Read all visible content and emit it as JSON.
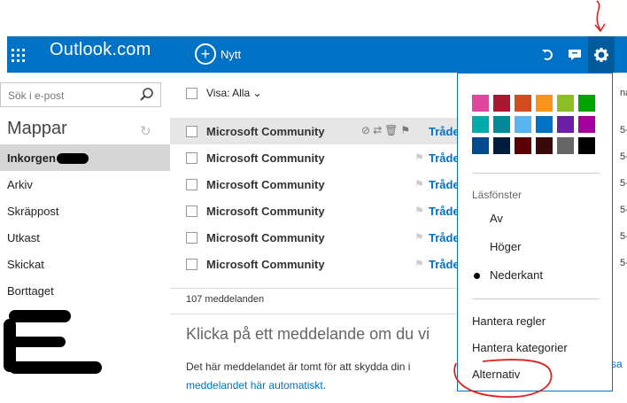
{
  "header": {
    "brand": "Outlook.com",
    "new_label": "Nytt",
    "new_icon": "+",
    "icons": [
      "undo-icon",
      "chat-icon",
      "gear-icon"
    ]
  },
  "search": {
    "placeholder": "Sök i e-post"
  },
  "folders": {
    "heading": "Mappar",
    "items": [
      {
        "label": "Inkorgen",
        "selected": true
      },
      {
        "label": "Arkiv"
      },
      {
        "label": "Skräppost"
      },
      {
        "label": "Utkast"
      },
      {
        "label": "Skickat"
      },
      {
        "label": "Borttaget"
      }
    ]
  },
  "list": {
    "filter_label": "Visa: Alla",
    "rows": [
      {
        "sender": "Microsoft Community",
        "thread": "Tråde"
      },
      {
        "sender": "Microsoft Community",
        "thread": "Tråde"
      },
      {
        "sender": "Microsoft Community",
        "thread": "Tråde"
      },
      {
        "sender": "Microsoft Community",
        "thread": "Tråde"
      },
      {
        "sender": "Microsoft Community",
        "thread": "Tråde"
      },
      {
        "sender": "Microsoft Community",
        "thread": "Tråde"
      }
    ],
    "message_count": "107 meddelanden",
    "peek": {
      "top": "na",
      "dates": [
        "5-",
        "5-",
        "5-",
        "5-",
        "5-",
        "5-"
      ]
    }
  },
  "reading": {
    "title": "Klicka på ett meddelande om du vi",
    "body_line1": "Det här meddelandet är tomt för att skydda din i",
    "body_line2": "meddelandet här automatiskt.",
    "tail": "sa"
  },
  "settings_menu": {
    "colors": [
      "#e0469f",
      "#a6192e",
      "#d14c1f",
      "#f7941d",
      "#8cbf26",
      "#00a300",
      "#00aba9",
      "#008a99",
      "#59b4ef",
      "#0072c6",
      "#6a1fa6",
      "#a3009c",
      "#004b8d",
      "#001d3d",
      "#5c0008",
      "#3b0909",
      "#666666",
      "#000000"
    ],
    "reading_pane_label": "Läsfönster",
    "reading_pane_options": [
      {
        "label": "Av"
      },
      {
        "label": "Höger"
      },
      {
        "label": "Nederkant",
        "selected": true
      }
    ],
    "items": [
      "Hantera regler",
      "Hantera kategorier",
      "Alternativ"
    ]
  }
}
